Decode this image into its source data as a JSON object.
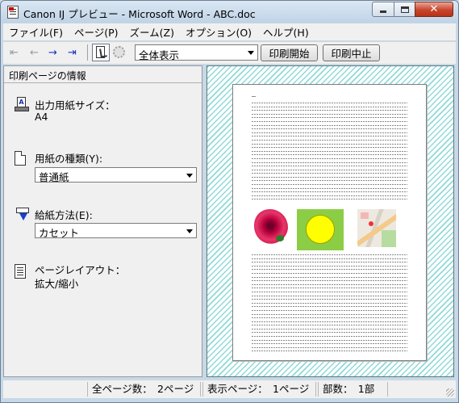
{
  "window": {
    "title": "Canon IJ プレビュー - Microsoft Word - ABC.doc"
  },
  "menu": [
    "ファイル(F)",
    "ページ(P)",
    "ズーム(Z)",
    "オプション(O)",
    "ヘルプ(H)"
  ],
  "toolbar": {
    "zoom_value": "全体表示",
    "start_print_label": "印刷開始",
    "stop_print_label": "印刷中止",
    "first_page_glyph": "⇤",
    "prev_page_glyph": "←",
    "next_page_glyph": "→",
    "last_page_glyph": "⇥"
  },
  "left_panel": {
    "header": "印刷ページの情報",
    "output_paper_size_label": "出力用紙サイズ：",
    "output_paper_size_value": "A4",
    "media_type_label": "用紙の種類(Y):",
    "media_type_value": "普通紙",
    "paper_source_label": "給紙方法(E):",
    "paper_source_value": "カセット",
    "page_layout_label": "ページレイアウト：",
    "page_layout_value": "拡大/縮小"
  },
  "status": {
    "total_pages": "全ページ数：　2ページ",
    "shown_page": "表示ページ：　1ページ",
    "copies": "部数：　1部"
  },
  "icons": {
    "paper_size_icon_letter": "A"
  },
  "colors": {
    "preview_stripe": "#8fd9d9",
    "close_button": "#c8452c",
    "nav_arrow_enabled": "#1930c4"
  }
}
